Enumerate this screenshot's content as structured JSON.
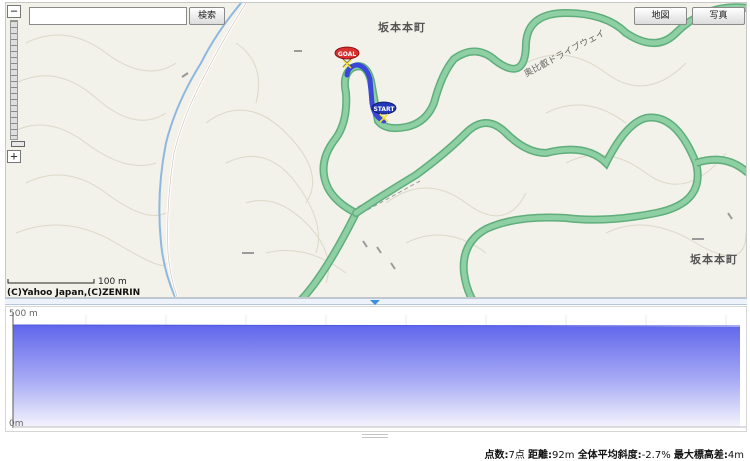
{
  "search": {
    "placeholder": "",
    "value": "",
    "button_label": "検索"
  },
  "map_modes": {
    "map_label": "地図",
    "photo_label": "写真"
  },
  "zoom": {
    "in_label": "−",
    "out_label": "+"
  },
  "map": {
    "place_labels": [
      "坂本本町",
      "坂本本町"
    ],
    "road_label": "奥比叡ドライブウェイ",
    "markers": {
      "goal_label": "GOAL",
      "start_label": "START"
    },
    "scale_text": "100 m",
    "copyright": "(C)Yahoo Japan,(C)ZENRIN"
  },
  "profile": {
    "ylabel_top": "500 m",
    "ylabel_bottom": "0m"
  },
  "stats": {
    "points_label": "点数:",
    "points_value": "7点",
    "distance_label": "距離:",
    "distance_value": "92m",
    "slope_label": "全体平均斜度:",
    "slope_value": "-2.7%",
    "elev_label": "最大標高差:",
    "elev_value": "4m"
  },
  "colors": {
    "map_bg": "#f2f1ea",
    "road_green": "#7fc694",
    "route_blue": "#3a47d8",
    "profile_fill": "#7077ee"
  }
}
